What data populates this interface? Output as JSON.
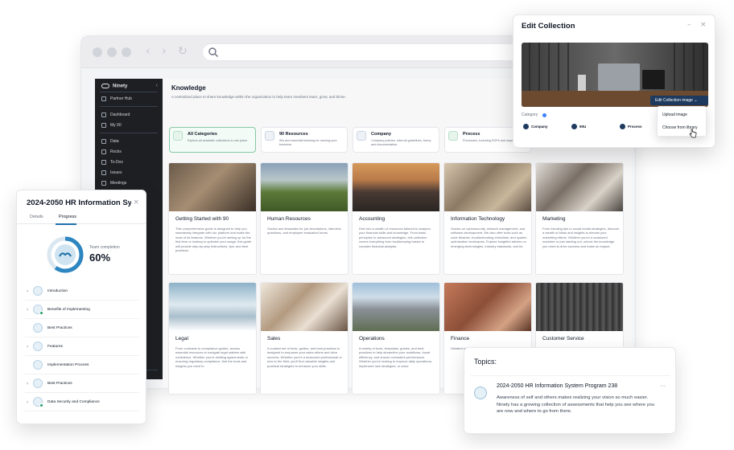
{
  "sidebar": {
    "brand": "Ninety",
    "items": [
      {
        "label": "Partner Hub",
        "icon": "partner-icon"
      },
      {
        "label": "Dashboard",
        "icon": "dashboard-icon"
      },
      {
        "label": "My 90",
        "icon": "user-icon"
      },
      {
        "label": "Data",
        "icon": "data-icon"
      },
      {
        "label": "Rocks",
        "icon": "rocks-icon"
      },
      {
        "label": "To-Dos",
        "icon": "todo-icon"
      },
      {
        "label": "Issues",
        "icon": "issues-icon"
      },
      {
        "label": "Meetings",
        "icon": "meetings-icon"
      }
    ]
  },
  "main": {
    "title": "Knowledge",
    "subtitle": "A centralized place to share knowledge within the organization to help team members learn, grow, and thrive.",
    "categories": [
      {
        "title": "All Categories",
        "desc": "Explore all available collections in one place."
      },
      {
        "title": "90 Resources",
        "desc": "90s and essential learning for running your business."
      },
      {
        "title": "Company",
        "desc": "Company policies, internal guidelines, forms, and documentation."
      },
      {
        "title": "Process",
        "desc": "Processes, including SOPs and ways"
      }
    ],
    "cards": [
      {
        "title": "Getting Started with 90",
        "desc": "This comprehensive guide is designed to help you seamlessly integrate with our platform and make the most of its features. Whether you're setting up for the first time or looking to optimize your usage, this guide will provide step-by-step instructions, tips, and best practices."
      },
      {
        "title": "Human Resources",
        "desc": "Guides and templates for job descriptions, interview questions, and employee evaluation forms."
      },
      {
        "title": "Accounting",
        "desc": "Dive into a wealth of resources tailored to sharpen your financial skills and knowledge. From basic principles to advanced strategies, this collection covers everything from bookkeeping basics to complex financial analysis."
      },
      {
        "title": "Information Technology",
        "desc": "Guides on cybersecurity, network management, and software development. We also offer tools such as code libraries, troubleshooting checklists, and system optimization techniques. Explore insightful articles on emerging technologies, industry standards, and be"
      },
      {
        "title": "Marketing",
        "desc": "From trending tips to social media strategies, discover a wealth of ideas and insights to elevate your marketing efforts. Whether you're a seasoned marketer or just starting out, unlock the knowledge you need to drive success and make an impact."
      },
      {
        "title": "Legal",
        "desc": "From contracts to compliance guides, access essential resources to navigate legal matters with confidence. Whether you're drafting agreements or ensuring regulatory compliance, find the tools and insights you need to"
      },
      {
        "title": "Sales",
        "desc": "A curated set of tools, guides, and best practices is designed to empower your sales efforts and drive success. Whether you're a seasoned professional or new to the field, you'll find valuable insights and practical strategies to enhance your skills"
      },
      {
        "title": "Operations",
        "desc": "A variety of tools, templates, guides, and best practices to help streamline your workflows, boost efficiency, and ensure consistent performance. Whether you're looking to improve daily operations, implement new strategies, or solve"
      },
      {
        "title": "Finance",
        "desc": "Detailed strategi"
      },
      {
        "title": "Customer Service",
        "desc": ""
      }
    ]
  },
  "edit_panel": {
    "title": "Edit Collection",
    "image_button": "Edit Collection image",
    "category_label": "Category",
    "chips": [
      "Company",
      "90U",
      "Process"
    ],
    "menu": [
      "Upload image",
      "Choose from library"
    ]
  },
  "progress_panel": {
    "title": "2024-2050 HR Information System",
    "tabs": [
      "Details",
      "Progress"
    ],
    "completion_label": "Team completion",
    "completion_value": "60%",
    "completion_fraction": 0.6,
    "items": [
      {
        "label": "Introduction",
        "chevron": true,
        "done": false
      },
      {
        "label": "Benefits of Implementing",
        "chevron": true,
        "done": true
      },
      {
        "label": "Best Practices",
        "chevron": false,
        "done": false
      },
      {
        "label": "Features",
        "chevron": true,
        "done": false
      },
      {
        "label": "Implementation Process",
        "chevron": false,
        "done": false
      },
      {
        "label": "Best Practices",
        "chevron": true,
        "done": false
      },
      {
        "label": "Data Security and Compliance",
        "chevron": true,
        "done": true
      }
    ]
  },
  "topics": {
    "label": "Topics:",
    "title": "2024-2050 HR Information System Program 238",
    "desc": "Awareness of self and others makes realizing your vision so much easier. Ninety has a growing collection of assessments that help you see where you are now and where to go from there."
  },
  "colors": {
    "accent": "#1e6fa8",
    "active_green": "#86c9a4",
    "sidebar_bg": "#1d1f23",
    "button_navy": "#1e3a5f"
  }
}
